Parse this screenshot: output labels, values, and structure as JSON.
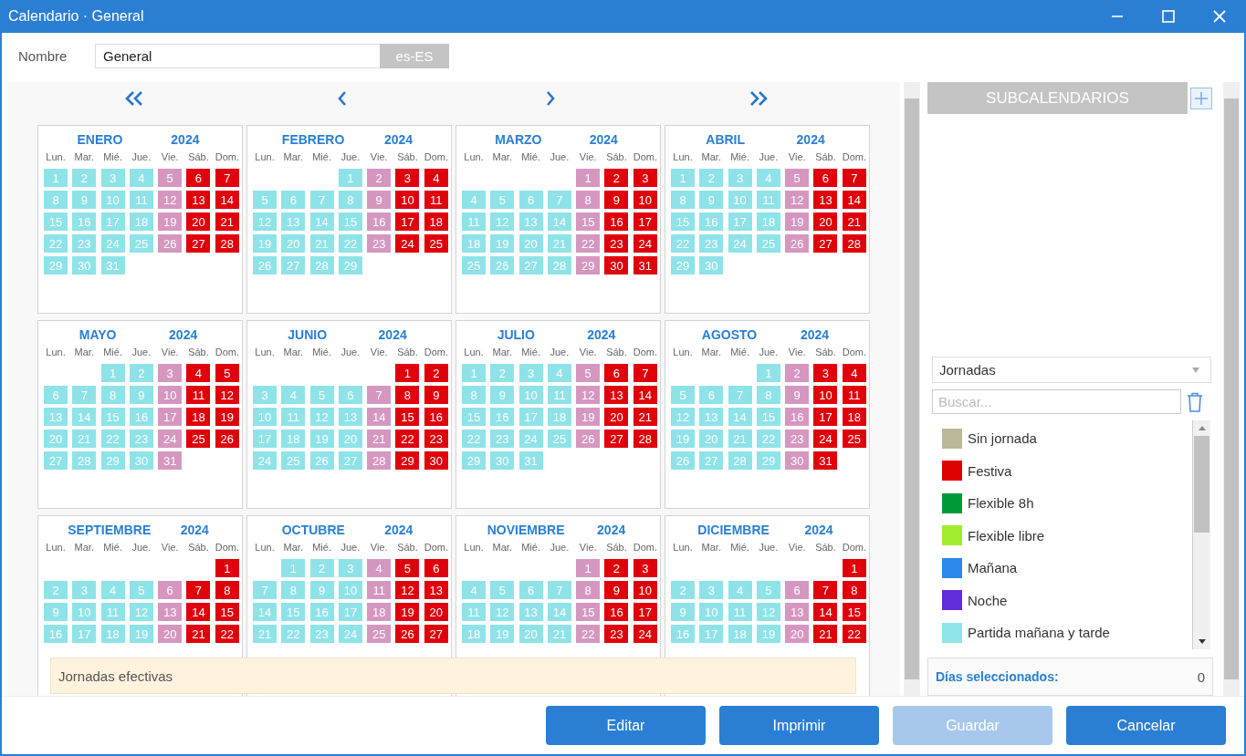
{
  "window": {
    "title": "Calendario · General"
  },
  "name_field": {
    "label": "Nombre",
    "value": "General",
    "locale": "es-ES"
  },
  "calendar": {
    "months": [
      {
        "name": "ENERO",
        "year": "2024",
        "weekdays": [
          "Lun.",
          "Mar.",
          "Mié.",
          "Jue.",
          "Vie.",
          "Sáb.",
          "Dom."
        ],
        "weeks": [
          [
            {
              "day": "1",
              "kind": "work"
            },
            {
              "day": "2",
              "kind": "work"
            },
            {
              "day": "3",
              "kind": "work"
            },
            {
              "day": "4",
              "kind": "work"
            },
            {
              "day": "5",
              "kind": "fri"
            },
            {
              "day": "6",
              "kind": "off"
            },
            {
              "day": "7",
              "kind": "off"
            }
          ],
          [
            {
              "day": "8",
              "kind": "work"
            },
            {
              "day": "9",
              "kind": "work"
            },
            {
              "day": "10",
              "kind": "work"
            },
            {
              "day": "11",
              "kind": "work"
            },
            {
              "day": "12",
              "kind": "fri"
            },
            {
              "day": "13",
              "kind": "off"
            },
            {
              "day": "14",
              "kind": "off"
            }
          ],
          [
            {
              "day": "15",
              "kind": "work"
            },
            {
              "day": "16",
              "kind": "work"
            },
            {
              "day": "17",
              "kind": "work"
            },
            {
              "day": "18",
              "kind": "work"
            },
            {
              "day": "19",
              "kind": "fri"
            },
            {
              "day": "20",
              "kind": "off"
            },
            {
              "day": "21",
              "kind": "off"
            }
          ],
          [
            {
              "day": "22",
              "kind": "work"
            },
            {
              "day": "23",
              "kind": "work"
            },
            {
              "day": "24",
              "kind": "work"
            },
            {
              "day": "25",
              "kind": "work"
            },
            {
              "day": "26",
              "kind": "fri"
            },
            {
              "day": "27",
              "kind": "off"
            },
            {
              "day": "28",
              "kind": "off"
            }
          ],
          [
            {
              "day": "29",
              "kind": "work"
            },
            {
              "day": "30",
              "kind": "work"
            },
            {
              "day": "31",
              "kind": "work"
            }
          ]
        ]
      },
      {
        "name": "FEBRERO",
        "year": "2024",
        "weekdays": [
          "Lun.",
          "Mar.",
          "Mié.",
          "Jue.",
          "Vie.",
          "Sáb.",
          "Dom."
        ],
        "weeks": [
          [
            {
              "kind": "blank"
            },
            {
              "kind": "blank"
            },
            {
              "kind": "blank"
            },
            {
              "day": "1",
              "kind": "work"
            },
            {
              "day": "2",
              "kind": "fri"
            },
            {
              "day": "3",
              "kind": "off"
            },
            {
              "day": "4",
              "kind": "off"
            }
          ],
          [
            {
              "day": "5",
              "kind": "work"
            },
            {
              "day": "6",
              "kind": "work"
            },
            {
              "day": "7",
              "kind": "work"
            },
            {
              "day": "8",
              "kind": "work"
            },
            {
              "day": "9",
              "kind": "fri"
            },
            {
              "day": "10",
              "kind": "off"
            },
            {
              "day": "11",
              "kind": "off"
            }
          ],
          [
            {
              "day": "12",
              "kind": "work"
            },
            {
              "day": "13",
              "kind": "work"
            },
            {
              "day": "14",
              "kind": "work"
            },
            {
              "day": "15",
              "kind": "work"
            },
            {
              "day": "16",
              "kind": "fri"
            },
            {
              "day": "17",
              "kind": "off"
            },
            {
              "day": "18",
              "kind": "off"
            }
          ],
          [
            {
              "day": "19",
              "kind": "work"
            },
            {
              "day": "20",
              "kind": "work"
            },
            {
              "day": "21",
              "kind": "work"
            },
            {
              "day": "22",
              "kind": "work"
            },
            {
              "day": "23",
              "kind": "fri"
            },
            {
              "day": "24",
              "kind": "off"
            },
            {
              "day": "25",
              "kind": "off"
            }
          ],
          [
            {
              "day": "26",
              "kind": "work"
            },
            {
              "day": "27",
              "kind": "work"
            },
            {
              "day": "28",
              "kind": "work"
            },
            {
              "day": "29",
              "kind": "work"
            }
          ]
        ]
      },
      {
        "name": "MARZO",
        "year": "2024",
        "weekdays": [
          "Lun.",
          "Mar.",
          "Mié.",
          "Jue.",
          "Vie.",
          "Sáb.",
          "Dom."
        ],
        "weeks": [
          [
            {
              "kind": "blank"
            },
            {
              "kind": "blank"
            },
            {
              "kind": "blank"
            },
            {
              "kind": "blank"
            },
            {
              "day": "1",
              "kind": "fri"
            },
            {
              "day": "2",
              "kind": "off"
            },
            {
              "day": "3",
              "kind": "off"
            }
          ],
          [
            {
              "day": "4",
              "kind": "work"
            },
            {
              "day": "5",
              "kind": "work"
            },
            {
              "day": "6",
              "kind": "work"
            },
            {
              "day": "7",
              "kind": "work"
            },
            {
              "day": "8",
              "kind": "fri"
            },
            {
              "day": "9",
              "kind": "off"
            },
            {
              "day": "10",
              "kind": "off"
            }
          ],
          [
            {
              "day": "11",
              "kind": "work"
            },
            {
              "day": "12",
              "kind": "work"
            },
            {
              "day": "13",
              "kind": "work"
            },
            {
              "day": "14",
              "kind": "work"
            },
            {
              "day": "15",
              "kind": "fri"
            },
            {
              "day": "16",
              "kind": "off"
            },
            {
              "day": "17",
              "kind": "off"
            }
          ],
          [
            {
              "day": "18",
              "kind": "work"
            },
            {
              "day": "19",
              "kind": "work"
            },
            {
              "day": "20",
              "kind": "work"
            },
            {
              "day": "21",
              "kind": "work"
            },
            {
              "day": "22",
              "kind": "fri"
            },
            {
              "day": "23",
              "kind": "off"
            },
            {
              "day": "24",
              "kind": "off"
            }
          ],
          [
            {
              "day": "25",
              "kind": "work"
            },
            {
              "day": "26",
              "kind": "work"
            },
            {
              "day": "27",
              "kind": "work"
            },
            {
              "day": "28",
              "kind": "work"
            },
            {
              "day": "29",
              "kind": "fri"
            },
            {
              "day": "30",
              "kind": "off"
            },
            {
              "day": "31",
              "kind": "off"
            }
          ]
        ]
      },
      {
        "name": "ABRIL",
        "year": "2024",
        "weekdays": [
          "Lun.",
          "Mar.",
          "Mié.",
          "Jue.",
          "Vie.",
          "Sáb.",
          "Dom."
        ],
        "weeks": [
          [
            {
              "day": "1",
              "kind": "work"
            },
            {
              "day": "2",
              "kind": "work"
            },
            {
              "day": "3",
              "kind": "work"
            },
            {
              "day": "4",
              "kind": "work"
            },
            {
              "day": "5",
              "kind": "fri"
            },
            {
              "day": "6",
              "kind": "off"
            },
            {
              "day": "7",
              "kind": "off"
            }
          ],
          [
            {
              "day": "8",
              "kind": "work"
            },
            {
              "day": "9",
              "kind": "work"
            },
            {
              "day": "10",
              "kind": "work"
            },
            {
              "day": "11",
              "kind": "work"
            },
            {
              "day": "12",
              "kind": "fri"
            },
            {
              "day": "13",
              "kind": "off"
            },
            {
              "day": "14",
              "kind": "off"
            }
          ],
          [
            {
              "day": "15",
              "kind": "work"
            },
            {
              "day": "16",
              "kind": "work"
            },
            {
              "day": "17",
              "kind": "work"
            },
            {
              "day": "18",
              "kind": "work"
            },
            {
              "day": "19",
              "kind": "fri"
            },
            {
              "day": "20",
              "kind": "off"
            },
            {
              "day": "21",
              "kind": "off"
            }
          ],
          [
            {
              "day": "22",
              "kind": "work"
            },
            {
              "day": "23",
              "kind": "work"
            },
            {
              "day": "24",
              "kind": "work"
            },
            {
              "day": "25",
              "kind": "work"
            },
            {
              "day": "26",
              "kind": "fri"
            },
            {
              "day": "27",
              "kind": "off"
            },
            {
              "day": "28",
              "kind": "off"
            }
          ],
          [
            {
              "day": "29",
              "kind": "work"
            },
            {
              "day": "30",
              "kind": "work"
            }
          ]
        ]
      },
      {
        "name": "MAYO",
        "year": "2024",
        "weekdays": [
          "Lun.",
          "Mar.",
          "Mié.",
          "Jue.",
          "Vie.",
          "Sáb.",
          "Dom."
        ],
        "weeks": [
          [
            {
              "kind": "blank"
            },
            {
              "kind": "blank"
            },
            {
              "day": "1",
              "kind": "work"
            },
            {
              "day": "2",
              "kind": "work"
            },
            {
              "day": "3",
              "kind": "fri"
            },
            {
              "day": "4",
              "kind": "off"
            },
            {
              "day": "5",
              "kind": "off"
            }
          ],
          [
            {
              "day": "6",
              "kind": "work"
            },
            {
              "day": "7",
              "kind": "work"
            },
            {
              "day": "8",
              "kind": "work"
            },
            {
              "day": "9",
              "kind": "work"
            },
            {
              "day": "10",
              "kind": "fri"
            },
            {
              "day": "11",
              "kind": "off"
            },
            {
              "day": "12",
              "kind": "off"
            }
          ],
          [
            {
              "day": "13",
              "kind": "work"
            },
            {
              "day": "14",
              "kind": "work"
            },
            {
              "day": "15",
              "kind": "work"
            },
            {
              "day": "16",
              "kind": "work"
            },
            {
              "day": "17",
              "kind": "fri"
            },
            {
              "day": "18",
              "kind": "off"
            },
            {
              "day": "19",
              "kind": "off"
            }
          ],
          [
            {
              "day": "20",
              "kind": "work"
            },
            {
              "day": "21",
              "kind": "work"
            },
            {
              "day": "22",
              "kind": "work"
            },
            {
              "day": "23",
              "kind": "work"
            },
            {
              "day": "24",
              "kind": "fri"
            },
            {
              "day": "25",
              "kind": "off"
            },
            {
              "day": "26",
              "kind": "off"
            }
          ],
          [
            {
              "day": "27",
              "kind": "work"
            },
            {
              "day": "28",
              "kind": "work"
            },
            {
              "day": "29",
              "kind": "work"
            },
            {
              "day": "30",
              "kind": "work"
            },
            {
              "day": "31",
              "kind": "fri"
            }
          ]
        ]
      },
      {
        "name": "JUNIO",
        "year": "2024",
        "weekdays": [
          "Lun.",
          "Mar.",
          "Mié.",
          "Jue.",
          "Vie.",
          "Sáb.",
          "Dom."
        ],
        "weeks": [
          [
            {
              "kind": "blank"
            },
            {
              "kind": "blank"
            },
            {
              "kind": "blank"
            },
            {
              "kind": "blank"
            },
            {
              "kind": "blank"
            },
            {
              "day": "1",
              "kind": "off"
            },
            {
              "day": "2",
              "kind": "off"
            }
          ],
          [
            {
              "day": "3",
              "kind": "work"
            },
            {
              "day": "4",
              "kind": "work"
            },
            {
              "day": "5",
              "kind": "work"
            },
            {
              "day": "6",
              "kind": "work"
            },
            {
              "day": "7",
              "kind": "fri"
            },
            {
              "day": "8",
              "kind": "off"
            },
            {
              "day": "9",
              "kind": "off"
            }
          ],
          [
            {
              "day": "10",
              "kind": "work"
            },
            {
              "day": "11",
              "kind": "work"
            },
            {
              "day": "12",
              "kind": "work"
            },
            {
              "day": "13",
              "kind": "work"
            },
            {
              "day": "14",
              "kind": "fri"
            },
            {
              "day": "15",
              "kind": "off"
            },
            {
              "day": "16",
              "kind": "off"
            }
          ],
          [
            {
              "day": "17",
              "kind": "work"
            },
            {
              "day": "18",
              "kind": "work"
            },
            {
              "day": "19",
              "kind": "work"
            },
            {
              "day": "20",
              "kind": "work"
            },
            {
              "day": "21",
              "kind": "fri"
            },
            {
              "day": "22",
              "kind": "off"
            },
            {
              "day": "23",
              "kind": "off"
            }
          ],
          [
            {
              "day": "24",
              "kind": "work"
            },
            {
              "day": "25",
              "kind": "work"
            },
            {
              "day": "26",
              "kind": "work"
            },
            {
              "day": "27",
              "kind": "work"
            },
            {
              "day": "28",
              "kind": "fri"
            },
            {
              "day": "29",
              "kind": "off"
            },
            {
              "day": "30",
              "kind": "off"
            }
          ]
        ]
      },
      {
        "name": "JULIO",
        "year": "2024",
        "weekdays": [
          "Lun.",
          "Mar.",
          "Mié.",
          "Jue.",
          "Vie.",
          "Sáb.",
          "Dom."
        ],
        "weeks": [
          [
            {
              "day": "1",
              "kind": "work"
            },
            {
              "day": "2",
              "kind": "work"
            },
            {
              "day": "3",
              "kind": "work"
            },
            {
              "day": "4",
              "kind": "work"
            },
            {
              "day": "5",
              "kind": "fri"
            },
            {
              "day": "6",
              "kind": "off"
            },
            {
              "day": "7",
              "kind": "off"
            }
          ],
          [
            {
              "day": "8",
              "kind": "work"
            },
            {
              "day": "9",
              "kind": "work"
            },
            {
              "day": "10",
              "kind": "work"
            },
            {
              "day": "11",
              "kind": "work"
            },
            {
              "day": "12",
              "kind": "fri"
            },
            {
              "day": "13",
              "kind": "off"
            },
            {
              "day": "14",
              "kind": "off"
            }
          ],
          [
            {
              "day": "15",
              "kind": "work"
            },
            {
              "day": "16",
              "kind": "work"
            },
            {
              "day": "17",
              "kind": "work"
            },
            {
              "day": "18",
              "kind": "work"
            },
            {
              "day": "19",
              "kind": "fri"
            },
            {
              "day": "20",
              "kind": "off"
            },
            {
              "day": "21",
              "kind": "off"
            }
          ],
          [
            {
              "day": "22",
              "kind": "work"
            },
            {
              "day": "23",
              "kind": "work"
            },
            {
              "day": "24",
              "kind": "work"
            },
            {
              "day": "25",
              "kind": "work"
            },
            {
              "day": "26",
              "kind": "fri"
            },
            {
              "day": "27",
              "kind": "off"
            },
            {
              "day": "28",
              "kind": "off"
            }
          ],
          [
            {
              "day": "29",
              "kind": "work"
            },
            {
              "day": "30",
              "kind": "work"
            },
            {
              "day": "31",
              "kind": "work"
            }
          ]
        ]
      },
      {
        "name": "AGOSTO",
        "year": "2024",
        "weekdays": [
          "Lun.",
          "Mar.",
          "Mié.",
          "Jue.",
          "Vie.",
          "Sáb.",
          "Dom."
        ],
        "weeks": [
          [
            {
              "kind": "blank"
            },
            {
              "kind": "blank"
            },
            {
              "kind": "blank"
            },
            {
              "day": "1",
              "kind": "work"
            },
            {
              "day": "2",
              "kind": "fri"
            },
            {
              "day": "3",
              "kind": "off"
            },
            {
              "day": "4",
              "kind": "off"
            }
          ],
          [
            {
              "day": "5",
              "kind": "work"
            },
            {
              "day": "6",
              "kind": "work"
            },
            {
              "day": "7",
              "kind": "work"
            },
            {
              "day": "8",
              "kind": "work"
            },
            {
              "day": "9",
              "kind": "fri"
            },
            {
              "day": "10",
              "kind": "off"
            },
            {
              "day": "11",
              "kind": "off"
            }
          ],
          [
            {
              "day": "12",
              "kind": "work"
            },
            {
              "day": "13",
              "kind": "work"
            },
            {
              "day": "14",
              "kind": "work"
            },
            {
              "day": "15",
              "kind": "work"
            },
            {
              "day": "16",
              "kind": "fri"
            },
            {
              "day": "17",
              "kind": "off"
            },
            {
              "day": "18",
              "kind": "off"
            }
          ],
          [
            {
              "day": "19",
              "kind": "work"
            },
            {
              "day": "20",
              "kind": "work"
            },
            {
              "day": "21",
              "kind": "work"
            },
            {
              "day": "22",
              "kind": "work"
            },
            {
              "day": "23",
              "kind": "fri"
            },
            {
              "day": "24",
              "kind": "off"
            },
            {
              "day": "25",
              "kind": "off"
            }
          ],
          [
            {
              "day": "26",
              "kind": "work"
            },
            {
              "day": "27",
              "kind": "work"
            },
            {
              "day": "28",
              "kind": "work"
            },
            {
              "day": "29",
              "kind": "work"
            },
            {
              "day": "30",
              "kind": "fri"
            },
            {
              "day": "31",
              "kind": "off"
            }
          ]
        ]
      },
      {
        "name": "SEPTIEMBRE",
        "year": "2024",
        "weekdays": [
          "Lun.",
          "Mar.",
          "Mié.",
          "Jue.",
          "Vie.",
          "Sáb.",
          "Dom."
        ],
        "weeks": [
          [
            {
              "kind": "blank"
            },
            {
              "kind": "blank"
            },
            {
              "kind": "blank"
            },
            {
              "kind": "blank"
            },
            {
              "kind": "blank"
            },
            {
              "kind": "blank"
            },
            {
              "day": "1",
              "kind": "off"
            }
          ],
          [
            {
              "day": "2",
              "kind": "work"
            },
            {
              "day": "3",
              "kind": "work"
            },
            {
              "day": "4",
              "kind": "work"
            },
            {
              "day": "5",
              "kind": "work"
            },
            {
              "day": "6",
              "kind": "fri"
            },
            {
              "day": "7",
              "kind": "off"
            },
            {
              "day": "8",
              "kind": "off"
            }
          ],
          [
            {
              "day": "9",
              "kind": "work"
            },
            {
              "day": "10",
              "kind": "work"
            },
            {
              "day": "11",
              "kind": "work"
            },
            {
              "day": "12",
              "kind": "work"
            },
            {
              "day": "13",
              "kind": "fri"
            },
            {
              "day": "14",
              "kind": "off"
            },
            {
              "day": "15",
              "kind": "off"
            }
          ],
          [
            {
              "day": "16",
              "kind": "work"
            },
            {
              "day": "17",
              "kind": "work"
            },
            {
              "day": "18",
              "kind": "work"
            },
            {
              "day": "19",
              "kind": "work"
            },
            {
              "day": "20",
              "kind": "fri"
            },
            {
              "day": "21",
              "kind": "off"
            },
            {
              "day": "22",
              "kind": "off"
            }
          ]
        ]
      },
      {
        "name": "OCTUBRE",
        "year": "2024",
        "weekdays": [
          "Lun.",
          "Mar.",
          "Mié.",
          "Jue.",
          "Vie.",
          "Sáb.",
          "Dom."
        ],
        "weeks": [
          [
            {
              "kind": "blank"
            },
            {
              "day": "1",
              "kind": "work"
            },
            {
              "day": "2",
              "kind": "work"
            },
            {
              "day": "3",
              "kind": "work"
            },
            {
              "day": "4",
              "kind": "fri"
            },
            {
              "day": "5",
              "kind": "off"
            },
            {
              "day": "6",
              "kind": "off"
            }
          ],
          [
            {
              "day": "7",
              "kind": "work"
            },
            {
              "day": "8",
              "kind": "work"
            },
            {
              "day": "9",
              "kind": "work"
            },
            {
              "day": "10",
              "kind": "work"
            },
            {
              "day": "11",
              "kind": "fri"
            },
            {
              "day": "12",
              "kind": "off"
            },
            {
              "day": "13",
              "kind": "off"
            }
          ],
          [
            {
              "day": "14",
              "kind": "work"
            },
            {
              "day": "15",
              "kind": "work"
            },
            {
              "day": "16",
              "kind": "work"
            },
            {
              "day": "17",
              "kind": "work"
            },
            {
              "day": "18",
              "kind": "fri"
            },
            {
              "day": "19",
              "kind": "off"
            },
            {
              "day": "20",
              "kind": "off"
            }
          ],
          [
            {
              "day": "21",
              "kind": "work"
            },
            {
              "day": "22",
              "kind": "work"
            },
            {
              "day": "23",
              "kind": "work"
            },
            {
              "day": "24",
              "kind": "work"
            },
            {
              "day": "25",
              "kind": "fri"
            },
            {
              "day": "26",
              "kind": "off"
            },
            {
              "day": "27",
              "kind": "off"
            }
          ]
        ]
      },
      {
        "name": "NOVIEMBRE",
        "year": "2024",
        "weekdays": [
          "Lun.",
          "Mar.",
          "Mié.",
          "Jue.",
          "Vie.",
          "Sáb.",
          "Dom."
        ],
        "weeks": [
          [
            {
              "kind": "blank"
            },
            {
              "kind": "blank"
            },
            {
              "kind": "blank"
            },
            {
              "kind": "blank"
            },
            {
              "day": "1",
              "kind": "fri"
            },
            {
              "day": "2",
              "kind": "off"
            },
            {
              "day": "3",
              "kind": "off"
            }
          ],
          [
            {
              "day": "4",
              "kind": "work"
            },
            {
              "day": "5",
              "kind": "work"
            },
            {
              "day": "6",
              "kind": "work"
            },
            {
              "day": "7",
              "kind": "work"
            },
            {
              "day": "8",
              "kind": "fri"
            },
            {
              "day": "9",
              "kind": "off"
            },
            {
              "day": "10",
              "kind": "off"
            }
          ],
          [
            {
              "day": "11",
              "kind": "work"
            },
            {
              "day": "12",
              "kind": "work"
            },
            {
              "day": "13",
              "kind": "work"
            },
            {
              "day": "14",
              "kind": "work"
            },
            {
              "day": "15",
              "kind": "fri"
            },
            {
              "day": "16",
              "kind": "off"
            },
            {
              "day": "17",
              "kind": "off"
            }
          ],
          [
            {
              "day": "18",
              "kind": "work"
            },
            {
              "day": "19",
              "kind": "work"
            },
            {
              "day": "20",
              "kind": "work"
            },
            {
              "day": "21",
              "kind": "work"
            },
            {
              "day": "22",
              "kind": "fri"
            },
            {
              "day": "23",
              "kind": "off"
            },
            {
              "day": "24",
              "kind": "off"
            }
          ]
        ]
      },
      {
        "name": "DICIEMBRE",
        "year": "2024",
        "weekdays": [
          "Lun.",
          "Mar.",
          "Mié.",
          "Jue.",
          "Vie.",
          "Sáb.",
          "Dom."
        ],
        "weeks": [
          [
            {
              "kind": "blank"
            },
            {
              "kind": "blank"
            },
            {
              "kind": "blank"
            },
            {
              "kind": "blank"
            },
            {
              "kind": "blank"
            },
            {
              "kind": "blank"
            },
            {
              "day": "1",
              "kind": "off"
            }
          ],
          [
            {
              "day": "2",
              "kind": "work"
            },
            {
              "day": "3",
              "kind": "work"
            },
            {
              "day": "4",
              "kind": "work"
            },
            {
              "day": "5",
              "kind": "work"
            },
            {
              "day": "6",
              "kind": "fri"
            },
            {
              "day": "7",
              "kind": "off"
            },
            {
              "day": "8",
              "kind": "off"
            }
          ],
          [
            {
              "day": "9",
              "kind": "work"
            },
            {
              "day": "10",
              "kind": "work"
            },
            {
              "day": "11",
              "kind": "work"
            },
            {
              "day": "12",
              "kind": "work"
            },
            {
              "day": "13",
              "kind": "fri"
            },
            {
              "day": "14",
              "kind": "off"
            },
            {
              "day": "15",
              "kind": "off"
            }
          ],
          [
            {
              "day": "16",
              "kind": "work"
            },
            {
              "day": "17",
              "kind": "work"
            },
            {
              "day": "18",
              "kind": "work"
            },
            {
              "day": "19",
              "kind": "work"
            },
            {
              "day": "20",
              "kind": "fri"
            },
            {
              "day": "21",
              "kind": "off"
            },
            {
              "day": "22",
              "kind": "off"
            }
          ]
        ]
      }
    ],
    "overlay": {
      "label": "Jornadas efectivas"
    }
  },
  "subcalendars": {
    "title": "SUBCALENDARIOS"
  },
  "jornadas": {
    "dropdown": "Jornadas",
    "search_placeholder": "Buscar...",
    "items": [
      {
        "label": "Sin jornada",
        "color": "#bab899"
      },
      {
        "label": "Festiva",
        "color": "#e00000"
      },
      {
        "label": "Flexible 8h",
        "color": "#009a38"
      },
      {
        "label": "Flexible libre",
        "color": "#a2ec30"
      },
      {
        "label": "Mañana",
        "color": "#2d88ea"
      },
      {
        "label": "Noche",
        "color": "#602cdc"
      },
      {
        "label": "Partida mañana y tarde",
        "color": "#8ee4e8"
      }
    ]
  },
  "selected_days": {
    "label": "Días seleccionados:",
    "count": "0"
  },
  "buttons": [
    {
      "label": "Editar",
      "disabled": false
    },
    {
      "label": "Imprimir",
      "disabled": false
    },
    {
      "label": "Guardar",
      "disabled": true
    },
    {
      "label": "Cancelar",
      "disabled": false
    }
  ]
}
